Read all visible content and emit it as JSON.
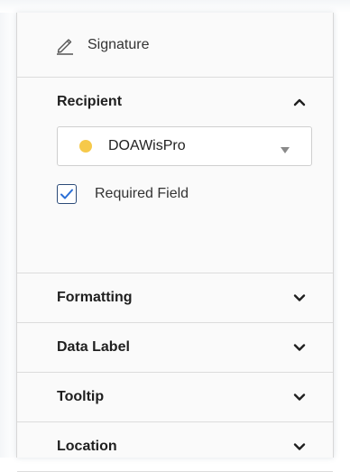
{
  "panel": {
    "title": "Signature",
    "title_icon": "pen-icon"
  },
  "recipient": {
    "header": "Recipient",
    "expanded": true,
    "selected": "DOAWisPro",
    "selected_color": "#f6c94a",
    "required_label": "Required Field",
    "required_checked": true
  },
  "sections": [
    {
      "label": "Formatting",
      "expanded": false
    },
    {
      "label": "Data Label",
      "expanded": false
    },
    {
      "label": "Tooltip",
      "expanded": false
    },
    {
      "label": "Location",
      "expanded": false
    }
  ],
  "colors": {
    "checkbox_accent": "#2b6fd6",
    "chevron": "#1f1f1f"
  }
}
